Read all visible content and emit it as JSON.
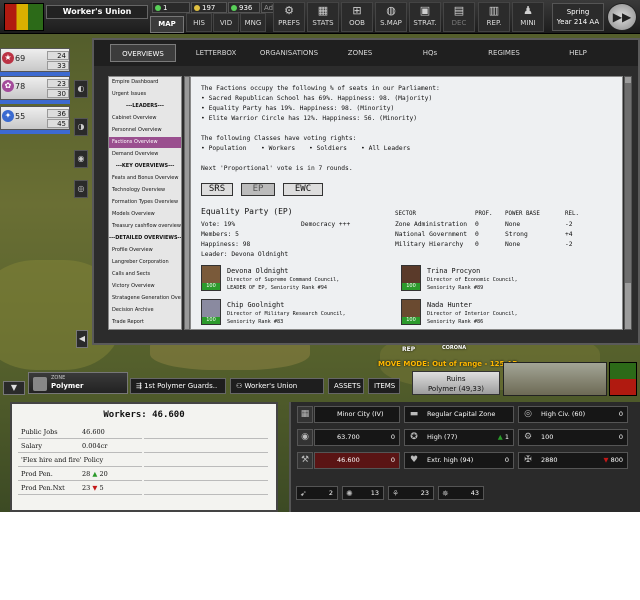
{
  "top_bar": {
    "faction_name": "Worker's Union",
    "resources": [
      {
        "value": "1",
        "color": "#58d058"
      },
      {
        "value": "197",
        "color": "#e0c040"
      },
      {
        "value": "936",
        "color": "#58d058"
      },
      {
        "value": "Ad",
        "color": "#888888"
      }
    ],
    "map_label": "MAP",
    "small_buttons": [
      "HIS",
      "VID",
      "MNG"
    ],
    "icon_buttons": [
      {
        "label": "PREFS",
        "icon": "gear-icon",
        "glyph": "⚙"
      },
      {
        "label": "STATS",
        "icon": "grid-icon",
        "glyph": "▦"
      },
      {
        "label": "OOB",
        "icon": "hierarchy-icon",
        "glyph": "⊞"
      },
      {
        "label": "S.MAP",
        "icon": "globe-icon",
        "glyph": "◍"
      },
      {
        "label": "STRAT.",
        "icon": "strategy-icon",
        "glyph": "▣"
      },
      {
        "label": "DEC",
        "icon": "decision-icon",
        "glyph": "▤"
      },
      {
        "label": "REP.",
        "icon": "report-icon",
        "glyph": "▥"
      },
      {
        "label": "MINI",
        "icon": "person-icon",
        "glyph": "♟"
      }
    ],
    "season": "Spring",
    "year": "Year 214 AA",
    "fast_forward_glyph": "▶▶"
  },
  "left_units": [
    {
      "badge": "★",
      "count": "69",
      "stat1": "24",
      "stat2": "33"
    },
    {
      "badge": "✿",
      "count": "78",
      "stat1": "23",
      "stat2": "30"
    },
    {
      "badge": "✦",
      "count": "55",
      "stat1": "36",
      "stat2": "45"
    }
  ],
  "window": {
    "tabs": [
      "OVERVIEWS",
      "LETTERBOX",
      "ORGANISATIONS",
      "ZONES",
      "HQs",
      "REGIMES",
      "HELP"
    ],
    "active_tab": "OVERVIEWS",
    "nav": [
      {
        "label": "Empire Dashboard",
        "type": "item"
      },
      {
        "label": "Urgent Issues",
        "type": "item"
      },
      {
        "label": "---LEADERS---",
        "type": "head"
      },
      {
        "label": "Cabinet Overview",
        "type": "item"
      },
      {
        "label": "Personnel Overview",
        "type": "item"
      },
      {
        "label": "Factions Overview",
        "type": "active"
      },
      {
        "label": "Demand Overview",
        "type": "item"
      },
      {
        "label": "---KEY OVERVIEWS---",
        "type": "head"
      },
      {
        "label": "Feats and Bonus Overview",
        "type": "item"
      },
      {
        "label": "Technology Overview",
        "type": "item"
      },
      {
        "label": "Formation Types Overview",
        "type": "item"
      },
      {
        "label": "Models Overview",
        "type": "item"
      },
      {
        "label": "Treasury cashflow overview",
        "type": "item"
      },
      {
        "label": "---DETAILED OVERVIEWS---",
        "type": "head"
      },
      {
        "label": "Profile Overview",
        "type": "item"
      },
      {
        "label": "Langreber Corporation",
        "type": "item"
      },
      {
        "label": "Calls and Sects",
        "type": "item"
      },
      {
        "label": "Victory Overview",
        "type": "item"
      },
      {
        "label": "Stratagene Generation Overv",
        "type": "item"
      },
      {
        "label": "Decision Archive",
        "type": "item"
      },
      {
        "label": "Trade Report",
        "type": "item"
      }
    ],
    "content": {
      "intro": "The Factions occupy the following % of seats in our Parliament:",
      "seats": [
        "• Sacred Republican School has 69%. Happiness: 98. (Majority)",
        "• Equality Party has 19%. Happiness: 98. (Minority)",
        "• Elite Warrior Circle has 12%. Happiness: 56. (Minority)"
      ],
      "voting_intro": "The following Classes have voting rights:",
      "voting_classes": [
        "• Population",
        "• Workers",
        "• Soldiers",
        "• All Leaders"
      ],
      "next_vote": "Next 'Proportional' vote is in 7 rounds.",
      "party_buttons": [
        "SRS",
        "EP",
        "EWC"
      ],
      "selected_party": "EP",
      "party_title": "Equality Party (EP)",
      "party_stats": {
        "vote": "Vote: 19%",
        "members": "Members: 5",
        "happiness": "Happiness: 98",
        "leader": "Leader: Devona Oldnight",
        "ideology": "Democracy +++"
      },
      "sector_table": {
        "headers": [
          "SECTOR",
          "PROF.",
          "POWER BASE",
          "REL."
        ],
        "rows": [
          [
            "Zone Administration",
            "0",
            "None",
            "-2"
          ],
          [
            "National Government",
            "0",
            "Strong",
            "+4"
          ],
          [
            "Military Hierarchy",
            "0",
            "None",
            "-2"
          ]
        ]
      },
      "members_list": [
        {
          "name": "Devona Oldnight",
          "role": "Director of Supreme Command Council,",
          "rank": "LEADER OF EP, Seniority Rank #94",
          "portrait_pct": "100",
          "portrait_color": "#7a5a3a"
        },
        {
          "name": "Trina Procyon",
          "role": "Director of Economic Council,",
          "rank": "Seniority Rank #89",
          "portrait_pct": "100",
          "portrait_color": "#5a3a2a"
        },
        {
          "name": "Chip Goolnight",
          "role": "Director of Military Research Council,",
          "rank": "Seniority Rank #83",
          "portrait_pct": "100",
          "portrait_color": "#8a8aa0"
        },
        {
          "name": "Nada Hunter",
          "role": "Director of Interior Council,",
          "rank": "Seniority Rank #86",
          "portrait_pct": "100",
          "portrait_color": "#6a4a30"
        }
      ]
    }
  },
  "map": {
    "rep_label": "REP",
    "corona_label": "CORONA",
    "move_mode": "MOVE MODE: Out of range - 125 AP",
    "ruins_title": "Ruins",
    "ruins_coords": "Polymer (49,33)"
  },
  "zone_bar": {
    "zone_small": "ZONE",
    "zone_name": "Polymer",
    "tabs": [
      "1st Polymer Guards..",
      "Worker's Union",
      "ASSETS",
      "ITEMS"
    ]
  },
  "workers": {
    "title": "Workers: 46.600",
    "rows": [
      {
        "label": "Public Jobs",
        "value": "46.600"
      },
      {
        "label": "Salary",
        "value": "0.004cr"
      },
      {
        "label": "'Flex hire and fire' Policy",
        "value": ""
      },
      {
        "label": "Prod Pen.",
        "value": "28",
        "arrow": "▲",
        "arrow_dir": "up",
        "change": "20"
      },
      {
        "label": "Prod Pen.Nxt",
        "value": "23",
        "arrow": "▼",
        "arrow_dir": "down",
        "change": "5"
      }
    ]
  },
  "stats": {
    "row1": [
      {
        "icon": "city-icon",
        "glyph": "▦",
        "text": "Minor City (IV)",
        "value": ""
      },
      {
        "icon": "capital-icon",
        "glyph": "▬",
        "text": "Regular Capital Zone",
        "value": ""
      },
      {
        "icon": "civilian-icon",
        "glyph": "◎",
        "text": "High Civ. (60)",
        "value": "0"
      }
    ],
    "row2": [
      {
        "icon": "population-icon",
        "glyph": "◉",
        "text": "63.700",
        "value": "0"
      },
      {
        "icon": "happiness-icon",
        "glyph": "✪",
        "text": "High (77)",
        "value": "1",
        "arrow": "▲"
      },
      {
        "icon": "gear-icon",
        "glyph": "⚙",
        "text": "100",
        "value": "0"
      }
    ],
    "row3": [
      {
        "icon": "workers-icon",
        "glyph": "⚒",
        "text": "46.600",
        "value": "0"
      },
      {
        "icon": "health-icon",
        "glyph": "♥",
        "text": "Extr. high (94)",
        "value": "0"
      },
      {
        "icon": "soldier-icon",
        "glyph": "✠",
        "text": "2880",
        "value": "800",
        "arrow": "▼"
      }
    ],
    "mini": [
      {
        "icon": "boot-icon",
        "glyph": "➹",
        "value": "2"
      },
      {
        "icon": "crowd-icon",
        "glyph": "✺",
        "value": "13"
      },
      {
        "icon": "mushroom-icon",
        "glyph": "⚘",
        "value": "23"
      },
      {
        "icon": "star-burst-icon",
        "glyph": "✵",
        "value": "43"
      }
    ]
  }
}
